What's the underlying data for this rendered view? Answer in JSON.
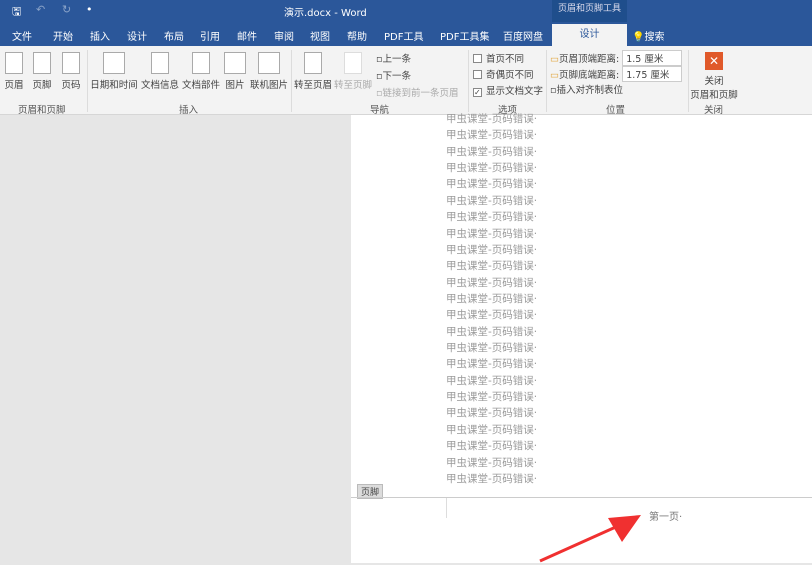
{
  "window": {
    "title": "演示.docx - Word",
    "context_tab_group": "页眉和页脚工具"
  },
  "qat": {
    "save": "🖫",
    "undo": "↶",
    "redo": "↻",
    "more": "•"
  },
  "tabs": [
    "文件",
    "开始",
    "插入",
    "设计",
    "布局",
    "引用",
    "邮件",
    "审阅",
    "视图",
    "帮助",
    "PDF工具",
    "PDF工具集",
    "百度网盘",
    "设计"
  ],
  "search": {
    "label": "搜索"
  },
  "ribbon": {
    "header_footer": {
      "buttons": [
        "页眉",
        "页脚",
        "页码"
      ],
      "group": "页眉和页脚"
    },
    "insert": {
      "buttons": [
        "日期和时间",
        "文档信息",
        "文档部件",
        "图片",
        "联机图片"
      ],
      "group": "插入"
    },
    "navigation": {
      "goto_header": "转至页眉",
      "goto_footer": "转至页脚",
      "prev": "上一条",
      "next": "下一条",
      "link_prev": "链接到前一条页眉",
      "group": "导航"
    },
    "options": {
      "items": [
        {
          "label": "首页不同",
          "checked": false
        },
        {
          "label": "奇偶页不同",
          "checked": false
        },
        {
          "label": "显示文档文字",
          "checked": true
        }
      ],
      "group": "选项"
    },
    "position": {
      "header_top_label": "页眉顶端距离:",
      "header_top_value": "1.5 厘米",
      "footer_bottom_label": "页脚底端距离:",
      "footer_bottom_value": "1.75 厘米",
      "insert_tab": "插入对齐制表位",
      "group": "位置"
    },
    "close": {
      "label1": "关闭",
      "label2": "页眉和页脚",
      "group": "关闭",
      "color": "#e0592a"
    }
  },
  "document": {
    "line_text": "甲虫课堂-页码错误·",
    "line_count": 23,
    "footer_tag": "页脚",
    "footer_text": "第一页·"
  }
}
